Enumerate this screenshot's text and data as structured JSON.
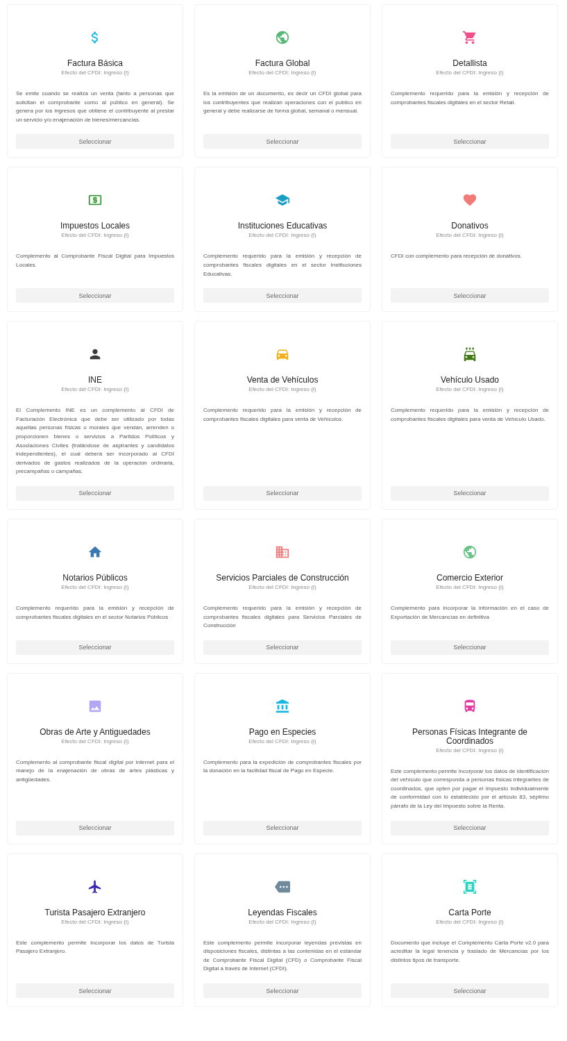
{
  "cards": [
    {
      "title": "Factura Básica",
      "effect": "Efecto del CFDI: Ingreso (I)",
      "description": "Se emite cuando se realiza un venta (tanto a personas que solicitan el comprobante como al público en general). Se genera por los ingresos que obtiene el contribuyente al prestar un servicio y/o enajenación de bienes/mercancías.",
      "button": "Seleccionar"
    },
    {
      "title": "Factura Global",
      "effect": "Efecto del CFDI: Ingreso (I)",
      "description": "Es la emisión de un documento, es decir un CFDI global para los contribuyentes que realizan operaciones con el publico en general y debe realizarse de forma global, semanal o mensual.",
      "button": "Seleccionar"
    },
    {
      "title": "Detallista",
      "effect": "Efecto del CFDI: Ingreso (I)",
      "description": "Complemento requerido para la emisión y recepción de comprobantes fiscales digitales en el sector Retail.",
      "button": "Seleccionar"
    },
    {
      "title": "Impuestos Locales",
      "effect": "Efecto del CFDI: Ingreso (I)",
      "description": "Complemento al Comprobante Fiscal Digital para Impuestos Locales.",
      "button": "Seleccionar"
    },
    {
      "title": "Instituciones Educativas",
      "effect": "Efecto del CFDI: Ingreso (I)",
      "description": "Complemento requerido para la emisión y recepción de comprobantes fiscales digitales en el sector Instituciones Educativas.",
      "button": "Seleccionar"
    },
    {
      "title": "Donativos",
      "effect": "Efecto del CFDI: Ingreso (I)",
      "description": "CFDI con complemento para recepción de donativos.",
      "button": "Seleccionar"
    },
    {
      "title": "INE",
      "effect": "Efecto del CFDI: Ingreso (I)",
      "description": "El Complemento INE es un complemento al CFDI de Facturación Electrónica que debe ser utilizado por todas aquellas personas físicas o morales que vendan, arrenden o proporcionen bienes o servicios a Partidos Políticos y Asociaciones Civiles (tratándose de aspirantes y candidatos independientes), el cual deberá ser incorporado al CFDI derivados de gastos realizados de la operación ordinaria, precampañas o campañas.",
      "button": "Seleccionar"
    },
    {
      "title": "Venta de Vehículos",
      "effect": "Efecto del CFDI: Ingreso (I)",
      "description": "Complemento requerido para la emisión y recepción de comprobantes fiscales digitales para venta de Vehículos.",
      "button": "Seleccionar"
    },
    {
      "title": "Vehículo Usado",
      "effect": "Efecto del CFDI: Ingreso (I)",
      "description": "Complemento requerido para la emisión y recepción de comprobantes fiscales digitales para venta de Vehículo Usado.",
      "button": "Seleccionar"
    },
    {
      "title": "Notarios Públicos",
      "effect": "Efecto del CFDI: Ingreso (I)",
      "description": "Complemento requerido para la emisión y recepción de comprobantes fiscales digitales en el sector Notarios Públicos",
      "button": "Seleccionar"
    },
    {
      "title": "Servicios Parciales de Construcción",
      "effect": "Efecto del CFDI: Ingreso (I)",
      "description": "Complemento requerido para la emisión y recepción de comprobantes fiscales digitales para Servicios Parciales de Construcción",
      "button": "Seleccionar"
    },
    {
      "title": "Comercio Exterior",
      "effect": "Efecto del CFDI: Ingreso (I)",
      "description": "Complemento para incorporar la información en el caso de Exportación de Mercancías en definitiva",
      "button": "Seleccionar"
    },
    {
      "title": "Obras de Arte y Antiguedades",
      "effect": "Efecto del CFDI: Ingreso (I)",
      "description": "Complemento al comprobante fiscal digital por internet para el manejo de la enajenación de obras de artes plásticas y antigüedades.",
      "button": "Seleccionar"
    },
    {
      "title": "Pago en Especies",
      "effect": "Efecto del CFDI: Ingreso (I)",
      "description": "Complemento para la expedición de comprobantes fiscales por la donación en la facilidad fiscal de Pago en Especie.",
      "button": "Seleccionar"
    },
    {
      "title": "Personas Físicas Integrante de Coordinados",
      "effect": "Efecto del CFDI: Ingreso (I)",
      "description": "Este complemento permite incorporar los datos de identificación del vehículo que corresponda a personas físicas integrantes de coordinados, que opten por pagar el impuesto individualmente de conformidad con lo establecido por el artículo 83, séptimo párrafo de la Ley del Impuesto sobre la Renta.",
      "button": "Seleccionar"
    },
    {
      "title": "Turista Pasajero Extranjero",
      "effect": "Efecto del CFDI: Ingreso (I)",
      "description": "Este complemento permite incorporar los datos de Turista Pasajero Extranjero.",
      "button": "Seleccionar"
    },
    {
      "title": "Leyendas Fiscales",
      "effect": "Efecto del CFDI: Ingreso (I)",
      "description": "Este complemento permite incorporar leyendas previstas en disposiciones fiscales, distintas a las contenidas en el estándar de Comprobante Fiscal Digital (CFD) o Comprobante Fiscal Digital a través de Internet (CFDI).",
      "button": "Seleccionar"
    },
    {
      "title": "Carta Porte",
      "effect": "Efecto del CFDI: Ingreso (I)",
      "description": "Documento que incluye el Complemento Carta Porte v2.0 para acreditar la legal tenencia y traslado de Mercancías por los distintos tipos de transporte.",
      "button": "Seleccionar"
    }
  ]
}
